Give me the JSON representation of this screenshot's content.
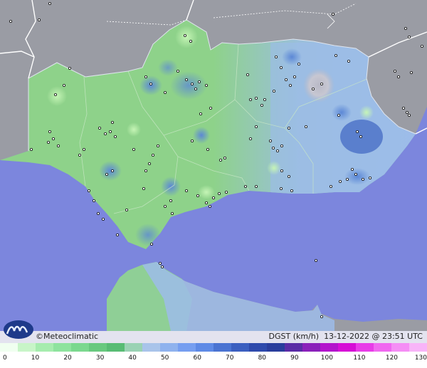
{
  "brand": "©Meteoclimatic",
  "info": {
    "variable": "DGST (km/h)",
    "datetime": "13-12-2022 @ 23:51 UTC"
  },
  "scale": {
    "ticks": [
      "0",
      "10",
      "20",
      "30",
      "40",
      "50",
      "60",
      "70",
      "80",
      "90",
      "100",
      "110",
      "120",
      "130"
    ],
    "colors": [
      "#f0fff0",
      "#c8f5c8",
      "#a6ecae",
      "#8ee39e",
      "#7bd88f",
      "#68c97f",
      "#58bc74",
      "#9ad2b4",
      "#a9c4ea",
      "#8fb2ee",
      "#769ef0",
      "#5e8ae6",
      "#4a73d2",
      "#3b5fc0",
      "#2e4aac",
      "#293d9c",
      "#5a2ca6",
      "#8a20ba",
      "#b314cc",
      "#d60fd6",
      "#e83ce8",
      "#f068f0",
      "#f58ef5",
      "#f8b4f8"
    ]
  },
  "colors": {
    "sea": "#7c86dd",
    "land_gray": "#9a9ca4",
    "andalusia_green": "#8ed28a",
    "andalusia_blue": "#9dbcea",
    "border": "#ffffff"
  }
}
